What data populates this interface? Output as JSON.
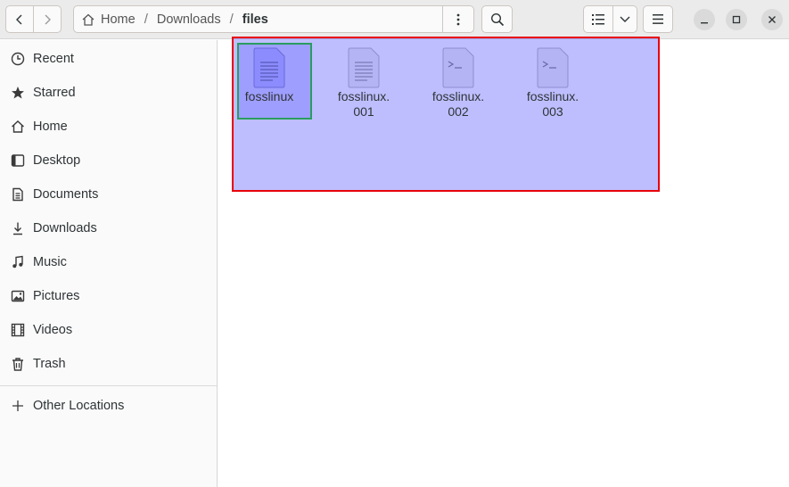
{
  "window": {
    "title": "files"
  },
  "header": {
    "back_icon": "chevron-left-icon",
    "forward_icon": "chevron-right-icon",
    "breadcrumb": [
      {
        "label": "Home",
        "icon": "home-icon"
      },
      {
        "label": "Downloads"
      },
      {
        "label": "files",
        "current": true
      }
    ],
    "separator": "/",
    "path_menu_icon": "vertical-dots-icon",
    "search_icon": "search-icon",
    "view_icon": "list-view-icon",
    "view_dropdown_icon": "chevron-down-icon",
    "menu_icon": "hamburger-menu-icon",
    "window_controls": [
      "minimize",
      "maximize",
      "close"
    ]
  },
  "sidebar": {
    "items": [
      {
        "label": "Recent",
        "icon": "clock-icon"
      },
      {
        "label": "Starred",
        "icon": "star-icon"
      },
      {
        "label": "Home",
        "icon": "home-icon"
      },
      {
        "label": "Desktop",
        "icon": "desktop-icon"
      },
      {
        "label": "Documents",
        "icon": "document-icon"
      },
      {
        "label": "Downloads",
        "icon": "download-icon"
      },
      {
        "label": "Music",
        "icon": "music-icon"
      },
      {
        "label": "Pictures",
        "icon": "picture-icon"
      },
      {
        "label": "Videos",
        "icon": "video-icon"
      },
      {
        "label": "Trash",
        "icon": "trash-icon"
      }
    ],
    "other": {
      "label": "Other Locations",
      "icon": "plus-icon"
    }
  },
  "files": [
    {
      "name": "fosslinux",
      "type": "text",
      "focused": true
    },
    {
      "name": "fosslinux.001",
      "type": "text"
    },
    {
      "name": "fosslinux.002",
      "type": "script"
    },
    {
      "name": "fosslinux.003",
      "type": "script"
    }
  ],
  "colors": {
    "selection_fill": "#8a8aff",
    "selection_border": "#e8000b",
    "focus_border": "#2a9d5f",
    "header_bg": "#ebebeb",
    "sidebar_bg": "#fafafa"
  }
}
